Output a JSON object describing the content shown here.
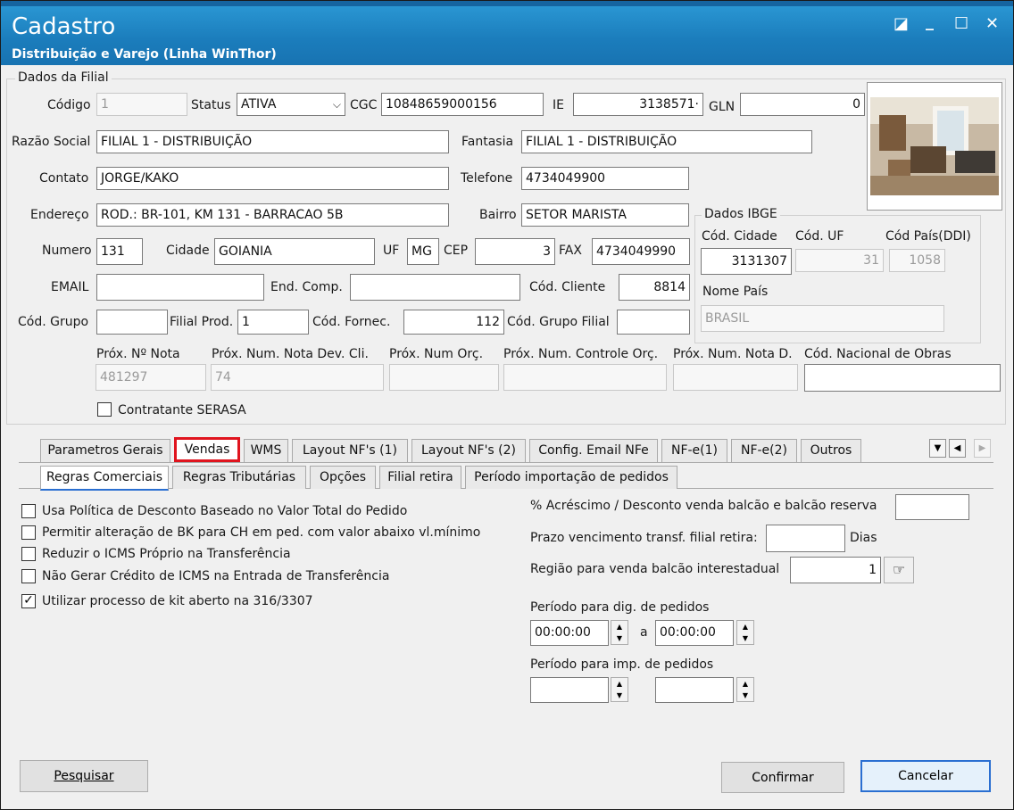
{
  "window": {
    "title": "Cadastro",
    "subtitle": "Distribuição e Varejo (Linha WinThor)",
    "controls": {
      "restore": "◪",
      "minimize": "_",
      "maximize": "☐",
      "close": "✕"
    }
  },
  "dados_filial": {
    "group_title": "Dados da Filial",
    "codigo": {
      "label": "Código",
      "value": "1"
    },
    "status": {
      "label": "Status",
      "value": "ATIVA"
    },
    "cgc": {
      "label": "CGC",
      "value": "10848659000156"
    },
    "ie": {
      "label": "IE",
      "value": "3138571·"
    },
    "gln": {
      "label": "GLN",
      "value": "0"
    },
    "razao_social": {
      "label": "Razão Social",
      "value": "FILIAL 1 - DISTRIBUIÇÃO"
    },
    "fantasia": {
      "label": "Fantasia",
      "value": "FILIAL 1 - DISTRIBUIÇÃO"
    },
    "contato": {
      "label": "Contato",
      "value": "JORGE/KAKO"
    },
    "telefone": {
      "label": "Telefone",
      "value": "4734049900"
    },
    "endereco": {
      "label": "Endereço",
      "value": "ROD.: BR-101, KM 131 - BARRACAO 5B"
    },
    "bairro": {
      "label": "Bairro",
      "value": "SETOR MARISTA"
    },
    "numero": {
      "label": "Numero",
      "value": "131"
    },
    "cidade": {
      "label": "Cidade",
      "value": "GOIANIA"
    },
    "uf": {
      "label": "UF",
      "value": "MG"
    },
    "cep": {
      "label": "CEP",
      "value": "3"
    },
    "fax": {
      "label": "FAX",
      "value": "4734049990"
    },
    "email": {
      "label": "EMAIL",
      "value": ""
    },
    "end_comp": {
      "label": "End. Comp.",
      "value": ""
    },
    "cod_cliente": {
      "label": "Cód. Cliente",
      "value": "8814"
    },
    "cod_grupo": {
      "label": "Cód. Grupo",
      "value": ""
    },
    "filial_prod": {
      "label": "Filial Prod.",
      "value": "1"
    },
    "cod_fornec": {
      "label": "Cód. Fornec.",
      "value": "112"
    },
    "cod_grupo_filial": {
      "label": "Cód. Grupo Filial",
      "value": ""
    },
    "prox_nota": {
      "label": "Próx. Nº Nota",
      "value": "481297"
    },
    "prox_nota_dev": {
      "label": "Próx. Num. Nota Dev. Cli.",
      "value": "74"
    },
    "prox_orc": {
      "label": "Próx. Num Orç.",
      "value": ""
    },
    "prox_controle_orc": {
      "label": "Próx. Num. Controle Orç.",
      "value": ""
    },
    "prox_nota_d": {
      "label": "Próx. Num. Nota D.",
      "value": ""
    },
    "cod_nacional_obras": {
      "label": "Cód. Nacional de Obras",
      "value": ""
    },
    "contratante_serasa": {
      "label": "Contratante SERASA",
      "checked": false
    }
  },
  "dados_ibge": {
    "group_title": "Dados IBGE",
    "cod_cidade": {
      "label": "Cód. Cidade",
      "value": "3131307"
    },
    "cod_uf": {
      "label": "Cód. UF",
      "value": "31"
    },
    "cod_pais": {
      "label": "Cód País(DDI)",
      "value": "1058"
    },
    "nome_pais": {
      "label": "Nome País",
      "value": "BRASIL"
    }
  },
  "tabs": [
    {
      "label": "Parametros Gerais"
    },
    {
      "label": "Vendas",
      "active": true,
      "highlighted": true
    },
    {
      "label": "WMS"
    },
    {
      "label": "Layout NF's (1)"
    },
    {
      "label": "Layout NF's (2)"
    },
    {
      "label": "Config. Email NFe"
    },
    {
      "label": "NF-e(1)"
    },
    {
      "label": "NF-e(2)"
    },
    {
      "label": "Outros"
    }
  ],
  "subtabs": [
    {
      "label": "Regras Comerciais",
      "active": true
    },
    {
      "label": "Regras Tributárias"
    },
    {
      "label": "Opções"
    },
    {
      "label": "Filial retira"
    },
    {
      "label": "Período importação de pedidos"
    }
  ],
  "regras": {
    "checkboxes": [
      {
        "label": "Usa Política de Desconto Baseado no Valor Total do Pedido",
        "checked": false
      },
      {
        "label": "Permitir alteração de BK para CH em ped. com valor abaixo vl.mínimo",
        "checked": false
      },
      {
        "label": "Reduzir o ICMS Próprio na Transferência",
        "checked": false
      },
      {
        "label": "Não Gerar Crédito de ICMS na Entrada de Transferência",
        "checked": false
      },
      {
        "label": "Utilizar processo de kit aberto na 316/3307",
        "checked": true
      }
    ],
    "acrescimo_label": "% Acréscimo / Desconto venda balcão e balcão reserva",
    "acrescimo_value": "",
    "prazo_label": "Prazo vencimento transf. filial retira:",
    "prazo_value": "",
    "dias_label": "Dias",
    "regiao_label": "Região para venda balcão interestadual",
    "regiao_value": "1",
    "periodo_dig_label": "Período para dig. de pedidos",
    "periodo_dig_de": "00:00:00",
    "periodo_a_label": "a",
    "periodo_dig_ate": "00:00:00",
    "periodo_imp_label": "Período para imp. de pedidos",
    "periodo_imp_de": "",
    "periodo_imp_ate": ""
  },
  "buttons": {
    "pesquisar": "Pesquisar",
    "confirmar": "Confirmar",
    "cancelar": "Cancelar"
  },
  "colors": {
    "titlebar": "#1b7dbc",
    "highlight": "#e0141e",
    "focus_border": "#2a6fd1"
  }
}
